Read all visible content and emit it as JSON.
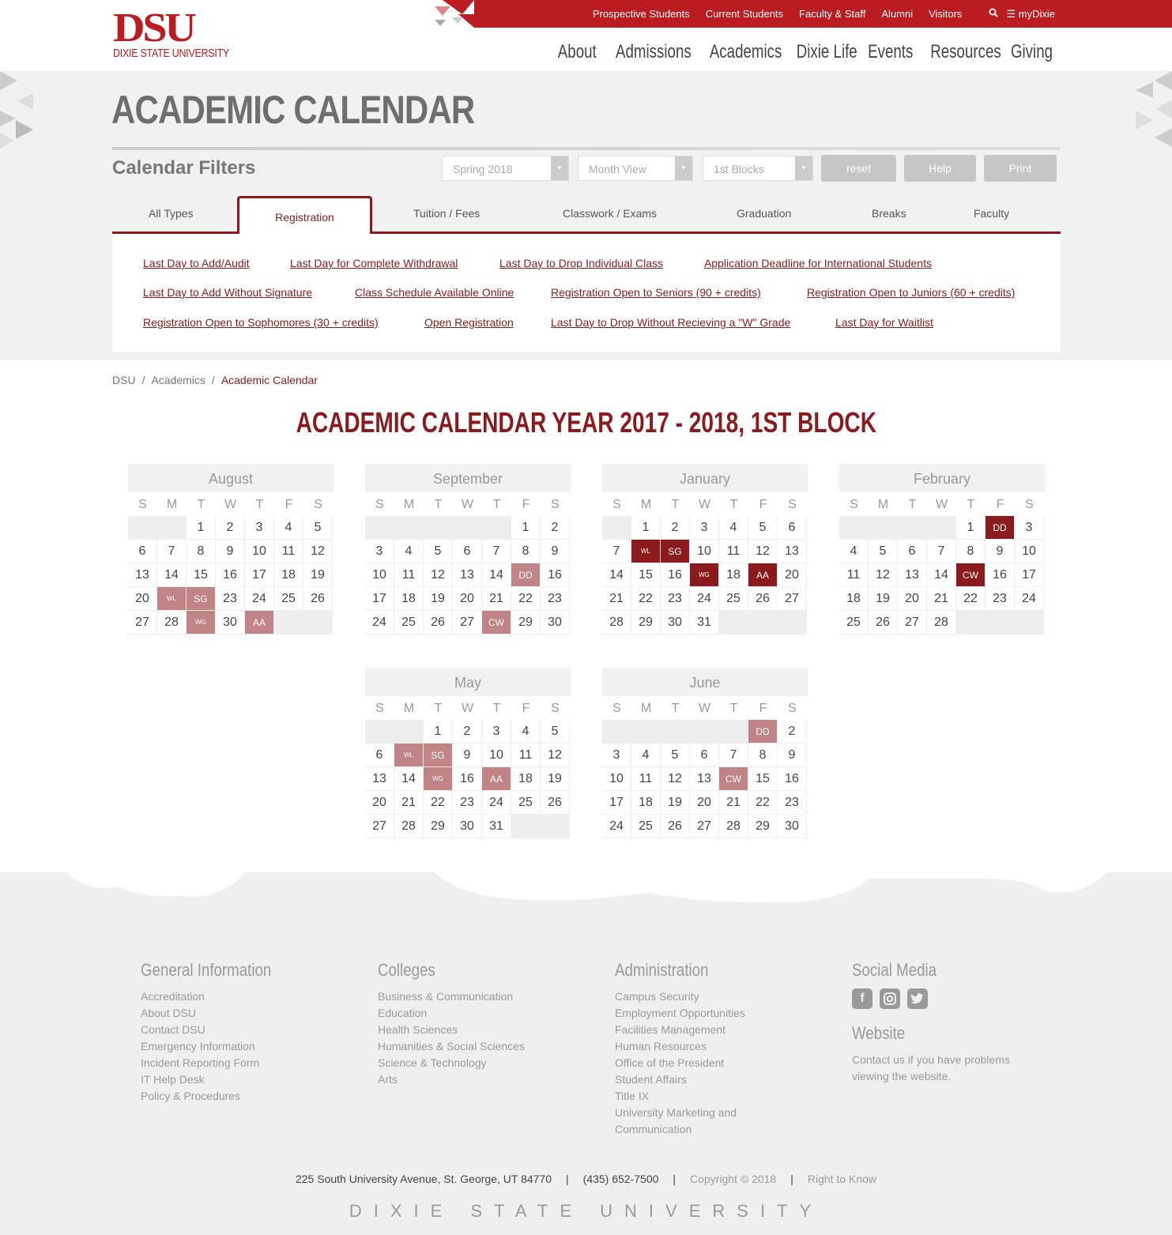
{
  "utility_nav": [
    "Prospective Students",
    "Current Students",
    "Faculty & Staff",
    "Alumni",
    "Visitors"
  ],
  "mydixie": "myDixie",
  "logo": {
    "main": "DSU",
    "sub": "DIXIE STATE UNIVERSITY"
  },
  "main_nav": [
    "About",
    "Admissions",
    "Academics",
    "Dixie Life",
    "Events",
    "Resources",
    "Giving"
  ],
  "page_title": "ACADEMIC CALENDAR",
  "filters": {
    "label": "Calendar Filters",
    "term": "Spring 2018",
    "view": "Month View",
    "block": "1st Blocks",
    "reset": "reset",
    "help": "Help",
    "print": "Print"
  },
  "tabs": [
    "All Types",
    "Registration",
    "Tuition / Fees",
    "Classwork / Exams",
    "Graduation",
    "Breaks",
    "Faculty"
  ],
  "active_tab": "Registration",
  "registration_links": [
    "Last Day to Add/Audit",
    "Last Day for Complete Withdrawal",
    "Last Day to Drop Individual Class",
    "Application Deadline for International Students",
    "Last Day to Add Without Signature",
    "Class Schedule Available Online",
    "Registration Open to Seniors (90 + credits)",
    "Registration Open to Juniors (60 + credits)",
    "Registration Open to Sophomores (30 + credits)",
    "Open Registration",
    "Last Day to Drop Without Recieving a \"W\" Grade",
    "Last Day for Waitlist"
  ],
  "breadcrumb": [
    "DSU",
    "Academics",
    "Academic Calendar"
  ],
  "calendar_title": "ACADEMIC CALENDAR YEAR 2017 - 2018, 1ST BLOCK",
  "weekdays": [
    "S",
    "M",
    "T",
    "W",
    "T",
    "F",
    "S"
  ],
  "months": [
    {
      "name": "August",
      "offset": 2,
      "days": 31,
      "marks": {
        "21": [
          "WL",
          "light"
        ],
        "22": [
          "SG",
          "light"
        ],
        "29": [
          "WG",
          "light"
        ],
        "31": [
          "AA",
          "light"
        ]
      }
    },
    {
      "name": "September",
      "offset": 5,
      "days": 30,
      "marks": {
        "15": [
          "DD",
          "light"
        ],
        "28": [
          "CW",
          "light"
        ]
      }
    },
    {
      "name": "January",
      "offset": 1,
      "days": 31,
      "marks": {
        "8": [
          "WL",
          "dark"
        ],
        "9": [
          "SG",
          "dark"
        ],
        "17": [
          "WG",
          "dark"
        ],
        "19": [
          "AA",
          "dark"
        ]
      }
    },
    {
      "name": "February",
      "offset": 4,
      "days": 28,
      "marks": {
        "2": [
          "DD",
          "dark"
        ],
        "15": [
          "CW",
          "dark"
        ]
      }
    },
    {
      "name": "May",
      "offset": 2,
      "days": 31,
      "marks": {
        "7": [
          "WL",
          "light"
        ],
        "8": [
          "SG",
          "light"
        ],
        "15": [
          "WG",
          "light"
        ],
        "17": [
          "AA",
          "light"
        ]
      }
    },
    {
      "name": "June",
      "offset": 5,
      "days": 30,
      "marks": {
        "1": [
          "DD",
          "light"
        ],
        "14": [
          "CW",
          "light"
        ]
      }
    }
  ],
  "colors": {
    "brand": "#ba1c21",
    "maroon": "#8b1a1d",
    "mark_light": "#c08487"
  },
  "footer": {
    "general": {
      "title": "General Information",
      "items": [
        "Accreditation",
        "About DSU",
        "Contact DSU",
        "Emergency Information",
        "Incident Reporting Form",
        "IT Help Desk",
        "Policy & Procedures"
      ]
    },
    "colleges": {
      "title": "Colleges",
      "items": [
        "Business & Communication",
        "Education",
        "Health Sciences",
        "Humanities & Social Sciences",
        "Science & Technology",
        "Arts"
      ]
    },
    "administration": {
      "title": "Administration",
      "items": [
        "Campus Security",
        "Employment Opportunities",
        "Facilities Management",
        "Human Resources",
        "Office of the President",
        "Student Affairs",
        "Title IX",
        "University Marketing and",
        "Communication"
      ]
    },
    "social": {
      "title": "Social Media",
      "icons": [
        "facebook-icon",
        "instagram-icon",
        "twitter-icon"
      ]
    },
    "website": {
      "title": "Website",
      "line1": "Contact us if you have problems",
      "line2": "viewing the website."
    },
    "address": "225 South University Avenue, St. George, UT 84770",
    "phone": "(435) 652-7500",
    "copyright": "Copyright © 2018",
    "right_to_know": "Right to Know",
    "brand": "DIXIE STATE UNIVERSITY"
  }
}
